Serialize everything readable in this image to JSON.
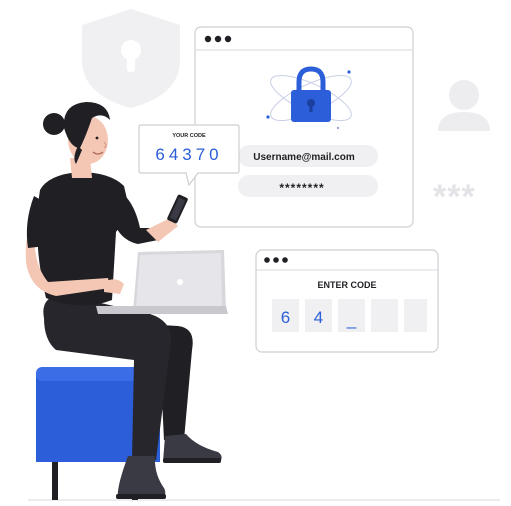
{
  "login_window": {
    "username": "Username@mail.com",
    "password_mask": "********"
  },
  "code_bubble": {
    "title": "YOUR CODE",
    "code": "64370"
  },
  "enter_code_window": {
    "title": "ENTER CODE",
    "digits": [
      "6",
      "4",
      "_",
      "",
      ""
    ]
  },
  "background_decor": {
    "password_asterisks": "***"
  },
  "icons": {
    "lock": "padlock-icon",
    "shield": "shield-keyhole-icon",
    "user": "user-silhouette-icon"
  },
  "colors": {
    "accent_blue": "#2b5ed8",
    "dark": "#1f1f24",
    "light_gray": "#f0f0f2",
    "stroke_gray": "#cfcfd4"
  }
}
